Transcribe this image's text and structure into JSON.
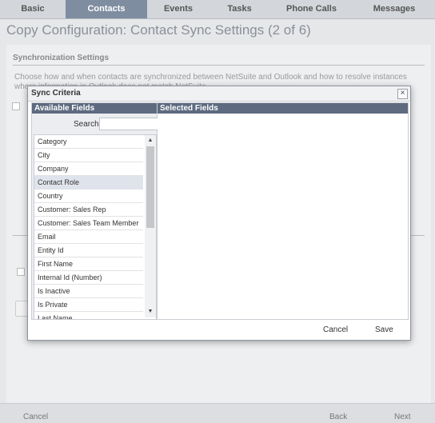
{
  "tabs": [
    "Basic",
    "Contacts",
    "Events",
    "Tasks",
    "Phone Calls",
    "Messages"
  ],
  "page_title": "Copy Configuration: Contact Sync Settings (2 of 6)",
  "section": {
    "title": "Synchronization Settings",
    "description": "Choose how and when contacts are synchronized between NetSuite and Outlook and how to resolve instances where information in Outlook does not match NetSuite."
  },
  "modal": {
    "title": "Sync Criteria",
    "close": "×",
    "available_header": "Available Fields",
    "selected_header": "Selected Fields",
    "search_label": "Search",
    "search_value": "",
    "fields": [
      "Category",
      "City",
      "Company",
      "Contact Role",
      "Country",
      "Customer: Sales Rep",
      "Customer: Sales Team Member",
      "Email",
      "Entity Id",
      "First Name",
      "Internal Id (Number)",
      "Is Inactive",
      "Is Private",
      "Last Name"
    ],
    "selected_index": 3,
    "cancel": "Cancel",
    "save": "Save"
  },
  "footer": {
    "cancel": "Cancel",
    "back": "Back",
    "next": "Next"
  },
  "colors": {
    "active_tab": "#7f8da0",
    "panel_header": "#5d6a80",
    "selected_row": "#dfe4ec"
  },
  "icons": {
    "close": "close-icon",
    "up": "arrow-up-icon",
    "down": "arrow-down-icon"
  }
}
